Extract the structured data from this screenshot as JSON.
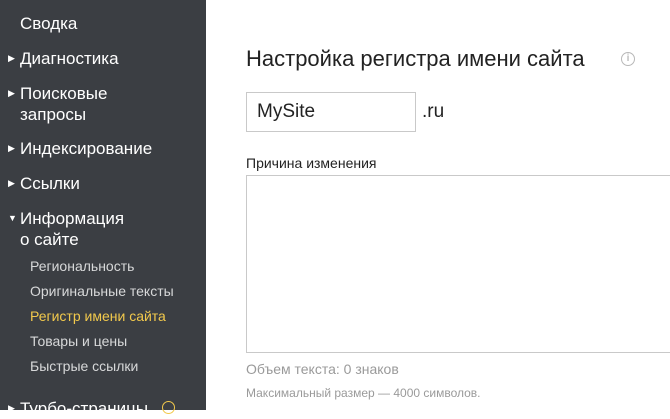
{
  "sidebar": {
    "items": [
      {
        "label": "Сводка",
        "arrow": ""
      },
      {
        "label": "Диагностика",
        "arrow": "▶"
      },
      {
        "label": "Поисковые\nзапросы",
        "arrow": "▶"
      },
      {
        "label": "Индексирование",
        "arrow": "▶"
      },
      {
        "label": "Ссылки",
        "arrow": "▶"
      },
      {
        "label": "Информация\nо сайте",
        "arrow": "▼"
      },
      {
        "label": "Турбо-страницы",
        "arrow": "▶"
      }
    ],
    "sub_items": [
      {
        "label": "Региональность"
      },
      {
        "label": "Оригинальные тексты"
      },
      {
        "label": "Регистр имени сайта"
      },
      {
        "label": "Товары и цены"
      },
      {
        "label": "Быстрые ссылки"
      }
    ],
    "active_sub_item_color": "#f2c94c",
    "background": "#3b3e43"
  },
  "main": {
    "title": "Настройка регистра имени сайта",
    "info_icon": "i",
    "site_name_input": {
      "value": "MySite"
    },
    "domain_suffix": ".ru",
    "reason_label": "Причина изменения",
    "reason_text": "",
    "char_count": "Объем текста: 0 знаков",
    "max_size": "Максимальный размер — 4000 символов."
  }
}
